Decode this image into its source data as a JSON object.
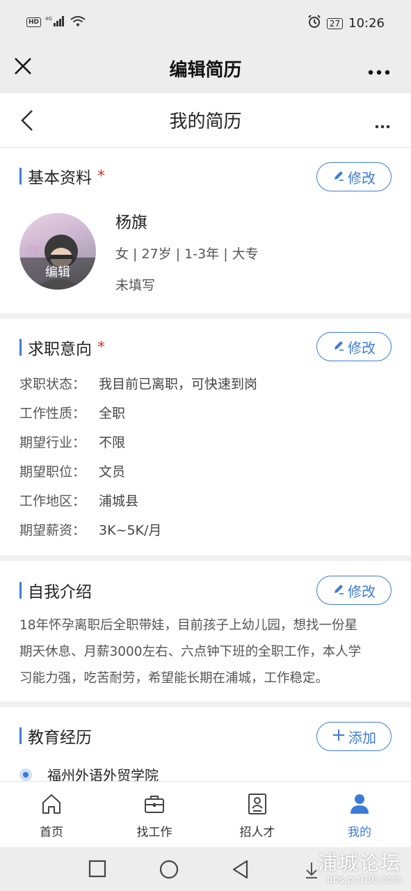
{
  "status_bar": {
    "time": "10:26",
    "battery": "27",
    "network": "4G"
  },
  "app_bar": {
    "title": "编辑简历"
  },
  "page_nav": {
    "title": "我的简历"
  },
  "basic_info": {
    "title": "基本资料",
    "required_mark": "*",
    "edit_label": "修改",
    "avatar_edit_label": "编辑",
    "name": "杨旗",
    "summary": "女 | 27岁 | 1-3年 | 大专",
    "extra": "未填写"
  },
  "job_intent": {
    "title": "求职意向",
    "required_mark": "*",
    "edit_label": "修改",
    "fields": [
      {
        "label": "求职状态：",
        "value": "我目前已离职，可快速到岗"
      },
      {
        "label": "工作性质：",
        "value": "全职"
      },
      {
        "label": "期望行业：",
        "value": "不限"
      },
      {
        "label": "期望职位：",
        "value": "文员"
      },
      {
        "label": "工作地区：",
        "value": "浦城县"
      },
      {
        "label": "期望薪资：",
        "value": "3K~5K/月"
      }
    ]
  },
  "self_intro": {
    "title": "自我介绍",
    "edit_label": "修改",
    "lines": [
      "18年怀孕离职后全职带娃，目前孩子上幼儿园，想找一份星",
      "期天休息、月薪3000左右、六点钟下班的全职工作，本人学",
      "习能力强，吃苦耐劳，希望能长期在浦城，工作稳定。"
    ]
  },
  "education": {
    "title": "教育经历",
    "add_label": "添加",
    "items": [
      {
        "school": "福州外语外贸学院"
      }
    ]
  },
  "tabs": [
    {
      "label": "首页",
      "icon": "home-icon"
    },
    {
      "label": "找工作",
      "icon": "briefcase-icon"
    },
    {
      "label": "招人才",
      "icon": "resume-icon"
    },
    {
      "label": "我的",
      "icon": "user-icon",
      "active": true
    }
  ],
  "watermark": {
    "text": "浦城论坛",
    "url": "bbs.pc186.com"
  },
  "colors": {
    "accent": "#3d7bd9",
    "required": "#d9302c"
  }
}
